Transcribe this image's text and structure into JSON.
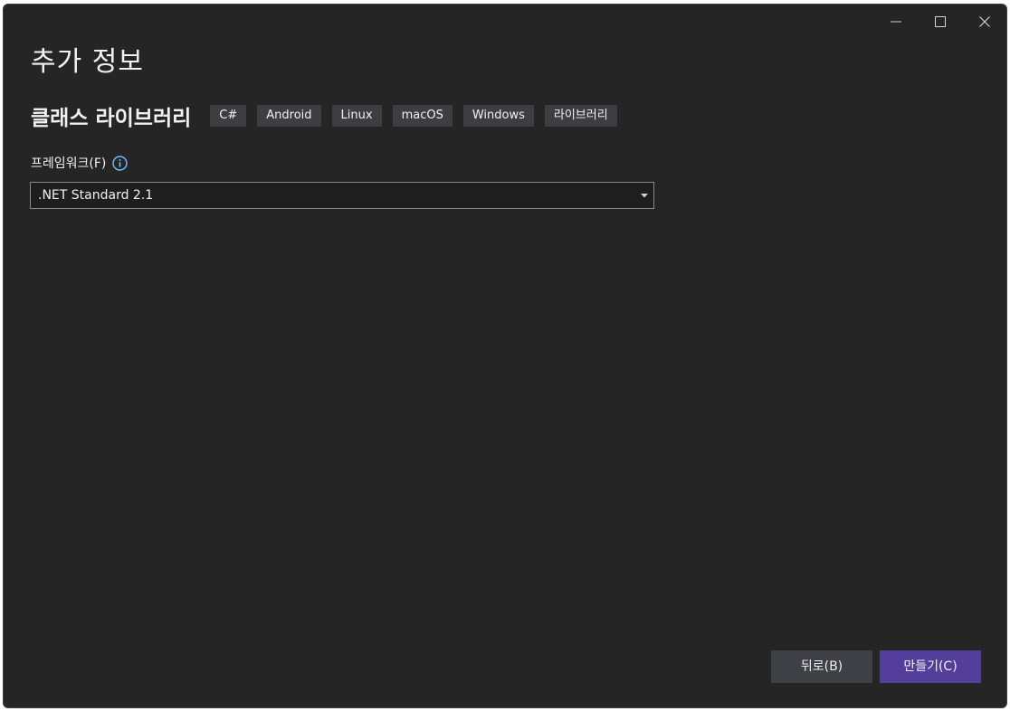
{
  "window": {
    "title": "추가 정보",
    "controls": {
      "minimize_icon": "minimize-icon",
      "maximize_icon": "maximize-icon",
      "close_icon": "close-icon"
    }
  },
  "template": {
    "name": "클래스 라이브러리",
    "tags": [
      "C#",
      "Android",
      "Linux",
      "macOS",
      "Windows",
      "라이브러리"
    ]
  },
  "framework": {
    "label": "프레임워크(F)",
    "info_icon": "info-icon",
    "selected": ".NET Standard 2.1"
  },
  "footer": {
    "back_label": "뒤로(B)",
    "create_label": "만들기(C)"
  },
  "colors": {
    "background": "#252526",
    "tag_background": "#3e3e42",
    "accent": "#533f9b",
    "secondary_button": "#3f3f46",
    "info_icon": "#75beff"
  }
}
